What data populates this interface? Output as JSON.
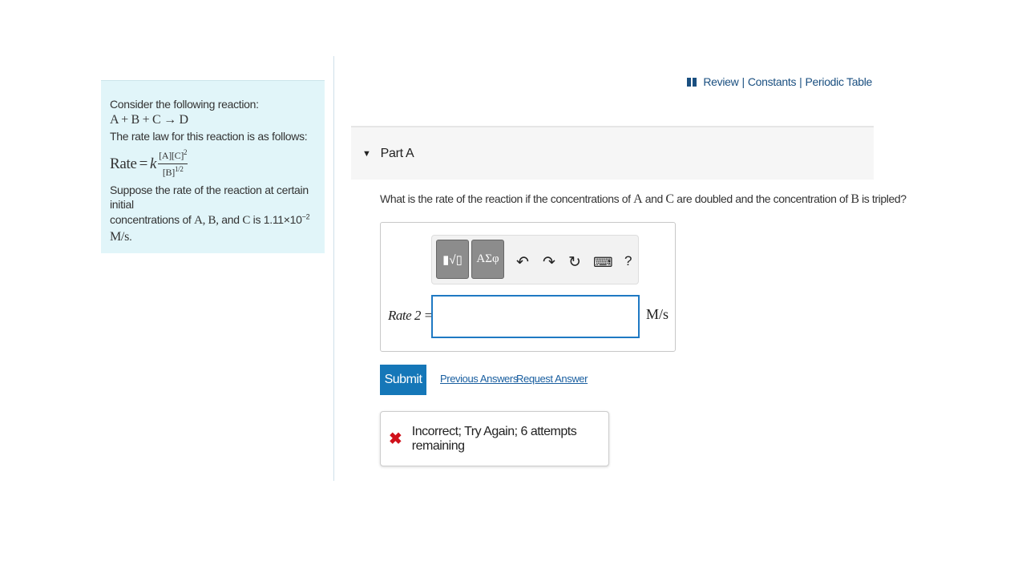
{
  "problem": {
    "intro": "Consider the following reaction:",
    "reaction": "A + B + C → D",
    "rate_law_intro": "The rate law for this reaction is as follows:",
    "rate_law": {
      "lhs": "Rate",
      "equals": "=",
      "k": "k",
      "numerator": "[A][C]",
      "numerator_exp": "2",
      "denominator": "[B]",
      "denominator_exp": "1/2"
    },
    "suppose_line1": "Suppose the rate of the reaction at certain initial",
    "suppose_line2_pre": "concentrations of ",
    "suppose_vars": "A, B,",
    "suppose_and": " and ",
    "suppose_var_c": "C",
    "suppose_is": " is ",
    "suppose_value": "1.11×10",
    "suppose_exp": "−2",
    "suppose_unit": "M/s",
    "suppose_end": "."
  },
  "top_links": {
    "review": "Review",
    "constants": "Constants",
    "periodic_table": "Periodic Table",
    "separator": "|"
  },
  "part": {
    "label": "Part A"
  },
  "question": {
    "pre": "What is the rate of the reaction if the concentrations of ",
    "var_a": "A",
    "and": " and ",
    "var_c": "C",
    "mid": " are doubled and the concentration of ",
    "var_b": "B",
    "post": " is tripled?"
  },
  "toolbar": {
    "templates_label": "▮√▯",
    "symbols_label": "ΑΣφ",
    "undo": "↶",
    "redo": "↷",
    "reset": "↻",
    "keyboard": "⌨",
    "help": "?"
  },
  "answer": {
    "label": "Rate 2 =",
    "value": "",
    "unit": "M/s"
  },
  "actions": {
    "submit": "Submit",
    "previous_answers": "Previous Answers",
    "request_answer": "Request Answer"
  },
  "feedback": {
    "icon": "✖",
    "message": "Incorrect; Try Again; 6 attempts remaining"
  }
}
